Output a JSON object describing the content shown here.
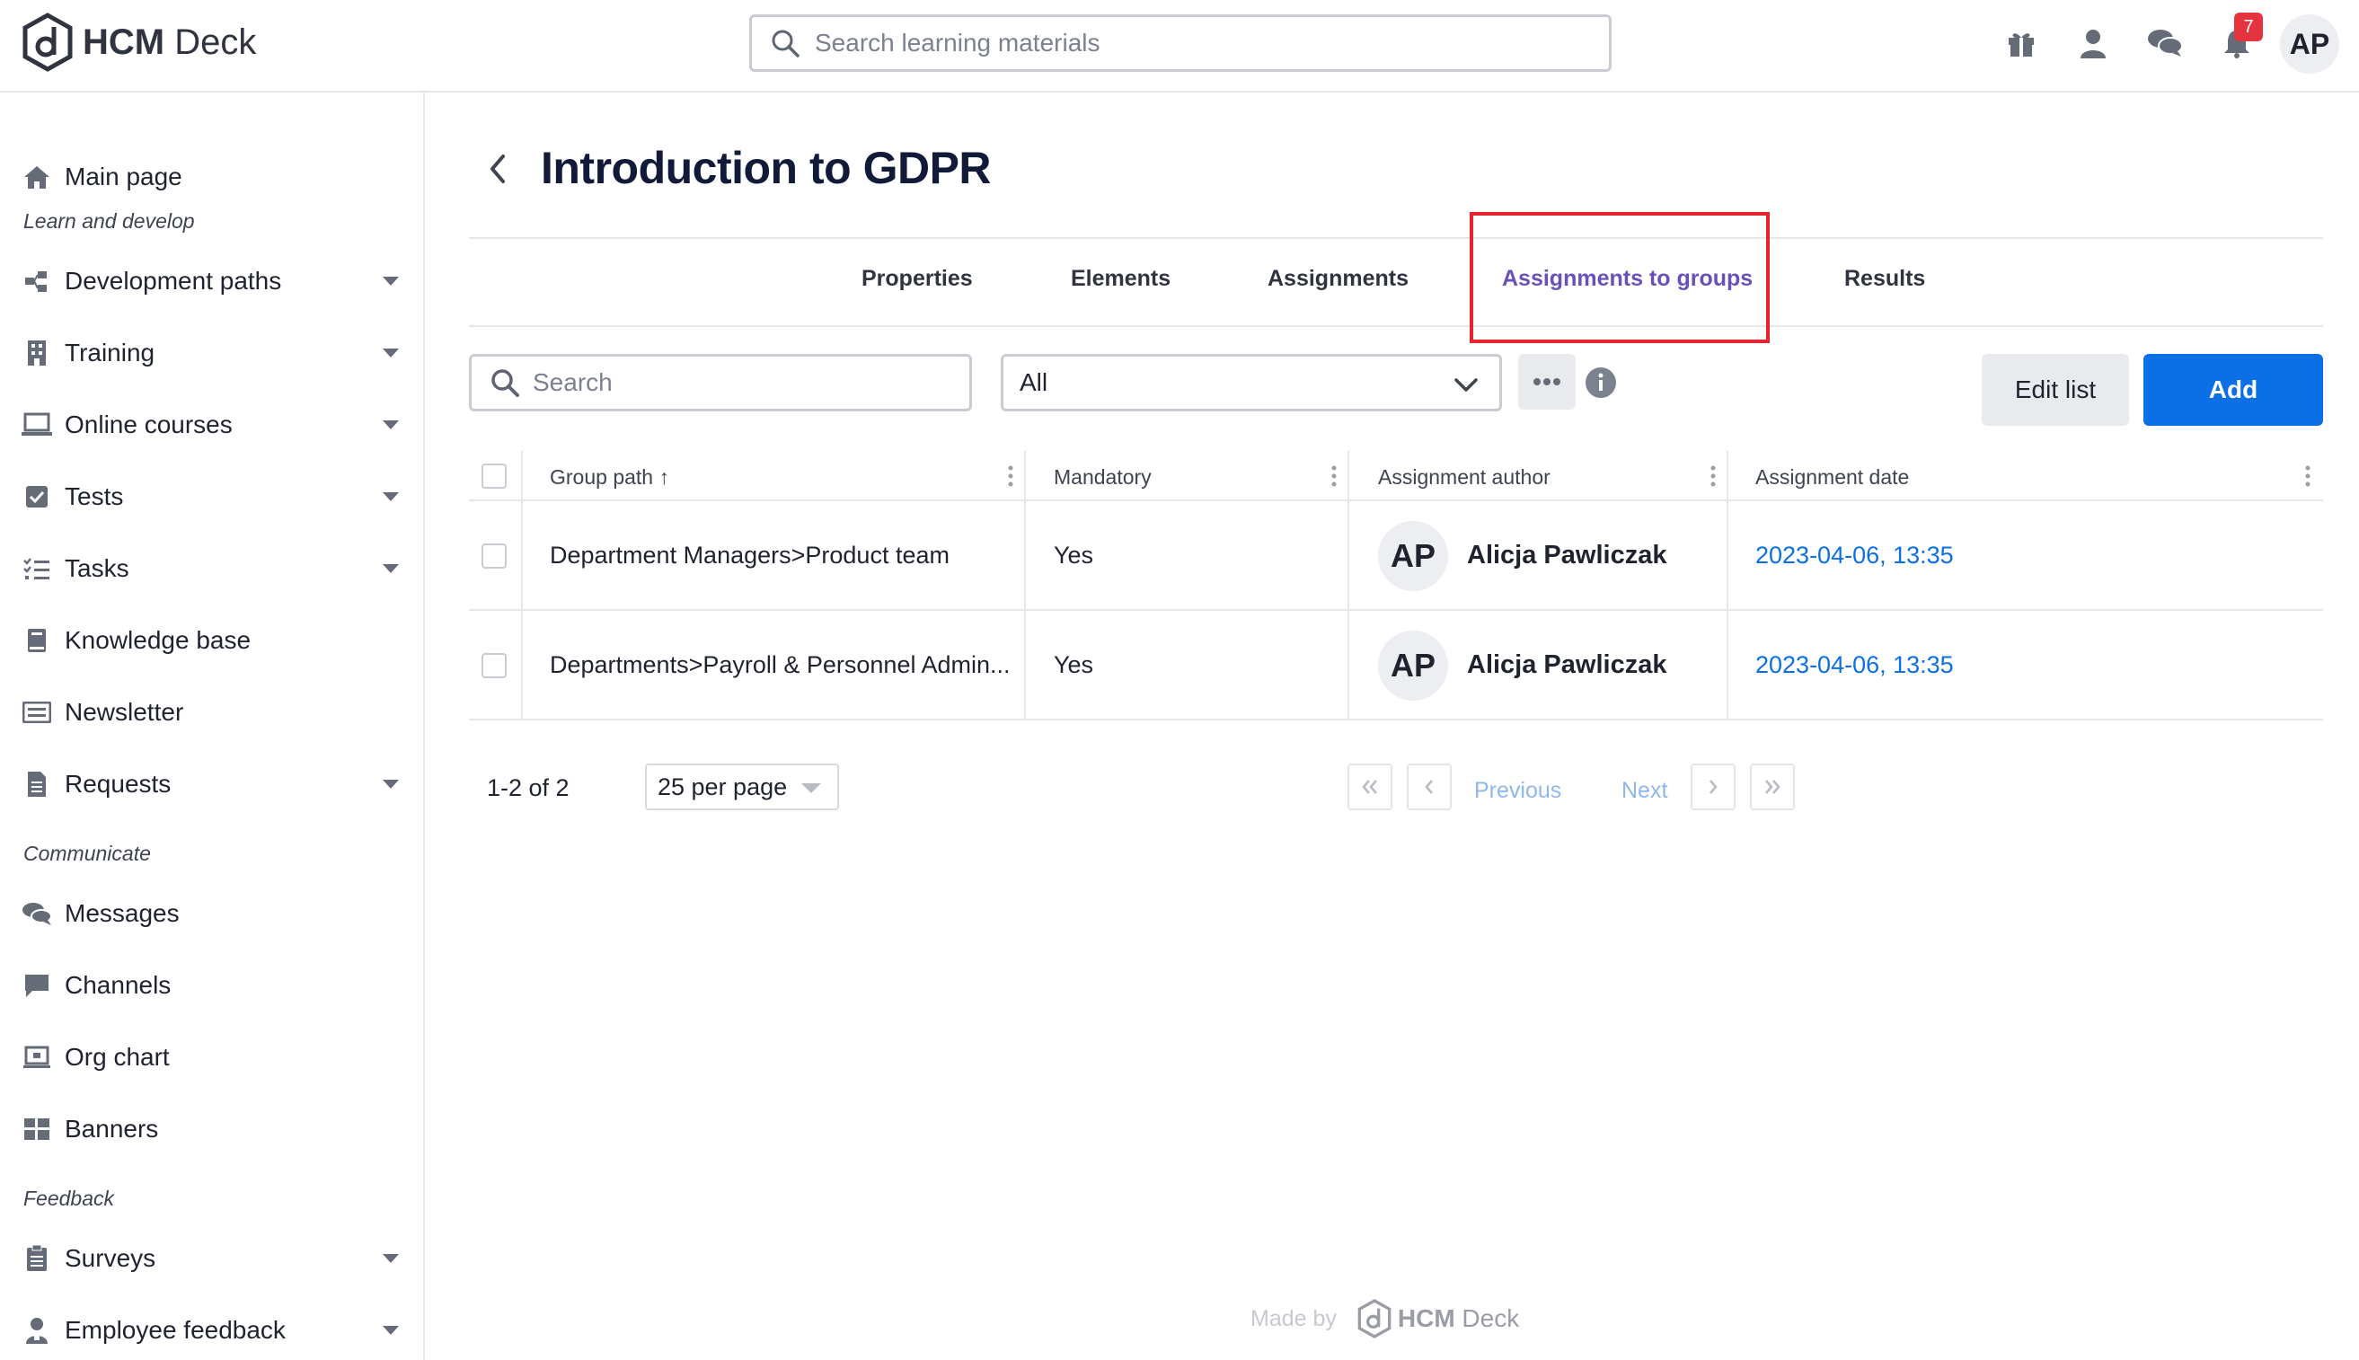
{
  "app": {
    "brand_bold": "HCM",
    "brand_rest": " Deck"
  },
  "header": {
    "search_placeholder": "Search learning materials",
    "notifications_count": "7",
    "user_initials": "AP"
  },
  "sidebar": {
    "main_page": "Main page",
    "sections": {
      "learn": "Learn and develop",
      "communicate": "Communicate",
      "feedback": "Feedback"
    },
    "items": [
      {
        "label": "Development paths",
        "icon": "development-paths-icon",
        "expandable": true
      },
      {
        "label": "Training",
        "icon": "training-icon",
        "expandable": true
      },
      {
        "label": "Online courses",
        "icon": "laptop-icon",
        "expandable": true
      },
      {
        "label": "Tests",
        "icon": "checkbox-icon",
        "expandable": true
      },
      {
        "label": "Tasks",
        "icon": "tasks-icon",
        "expandable": true
      },
      {
        "label": "Knowledge base",
        "icon": "book-icon",
        "expandable": false
      },
      {
        "label": "Newsletter",
        "icon": "newsletter-icon",
        "expandable": false
      },
      {
        "label": "Requests",
        "icon": "document-icon",
        "expandable": true
      },
      {
        "label": "Messages",
        "icon": "messages-icon",
        "expandable": false
      },
      {
        "label": "Channels",
        "icon": "channel-icon",
        "expandable": false
      },
      {
        "label": "Org chart",
        "icon": "org-chart-icon",
        "expandable": false
      },
      {
        "label": "Banners",
        "icon": "banners-icon",
        "expandable": false
      },
      {
        "label": "Surveys",
        "icon": "survey-icon",
        "expandable": true
      },
      {
        "label": "Employee feedback",
        "icon": "employee-feedback-icon",
        "expandable": true
      }
    ]
  },
  "page": {
    "title": "Introduction to GDPR",
    "tabs": [
      "Properties",
      "Elements",
      "Assignments",
      "Assignments to groups",
      "Results"
    ],
    "active_tab": "Assignments to groups"
  },
  "toolbar": {
    "search_placeholder": "Search",
    "filter_value": "All",
    "edit_list_label": "Edit list",
    "add_label": "Add"
  },
  "table": {
    "columns": [
      "Group path",
      "Mandatory",
      "Assignment author",
      "Assignment date"
    ],
    "sort_indicator": "↑",
    "rows": [
      {
        "group_path": "Department Managers>Product team",
        "mandatory": "Yes",
        "author_initials": "AP",
        "author": "Alicja Pawliczak",
        "date": "2023-04-06, 13:35"
      },
      {
        "group_path": "Departments>Payroll & Personnel Admin...",
        "mandatory": "Yes",
        "author_initials": "AP",
        "author": "Alicja Pawliczak",
        "date": "2023-04-06, 13:35"
      }
    ]
  },
  "pagination": {
    "range": "1-2 of 2",
    "per_page": "25 per page",
    "previous": "Previous",
    "next": "Next"
  },
  "footer": {
    "made_by": "Made by",
    "brand_bold": "HCM",
    "brand_rest": " Deck"
  },
  "colors": {
    "accent": "#0b6fe6",
    "active_tab": "#6b4fbb",
    "highlight": "#e3262d",
    "badge": "#e5343d"
  }
}
